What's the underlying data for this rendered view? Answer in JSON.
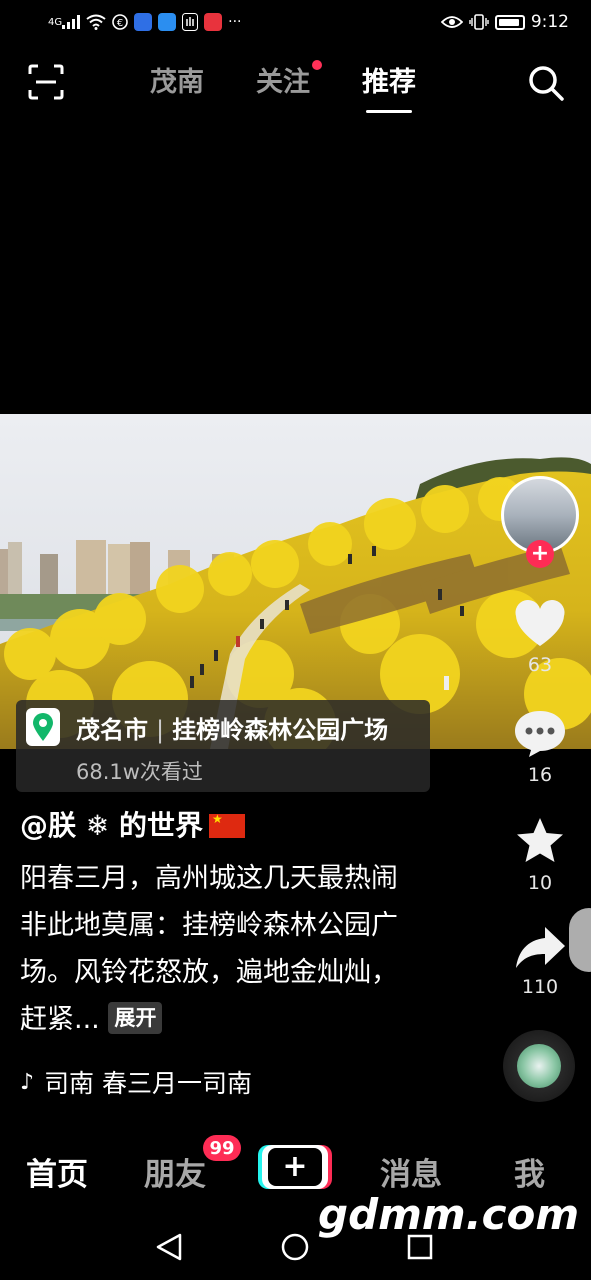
{
  "status_bar": {
    "signal": "4G",
    "more": "···",
    "time": "9:12"
  },
  "top_nav": {
    "tabs": [
      {
        "label": "茂南",
        "active": false
      },
      {
        "label": "关注",
        "active": false,
        "has_dot": true
      },
      {
        "label": "推荐",
        "active": true
      }
    ]
  },
  "video": {
    "location": {
      "city": "茂名市",
      "place": "挂榜岭森林公园广场",
      "views": "68.1w次看过"
    }
  },
  "rail": {
    "likes": "63",
    "comments": "16",
    "favorites": "10",
    "shares": "110"
  },
  "post": {
    "author": "@朕 ❄ 的世界",
    "caption": "阳春三月，高州城这几天最热闹非此地莫属：挂榜岭森林公园广场。风铃花怒放，遍地金灿灿，赶紧...",
    "expand_label": "展开",
    "music": "司南    春三月一司南"
  },
  "bottom_nav": {
    "home": "首页",
    "friends": "朋友",
    "friends_badge": "99",
    "plus": "+",
    "messages": "消息",
    "me": "我"
  },
  "watermark": "gdmm.com",
  "colors": {
    "accent_red": "#fe2c55",
    "accent_cyan": "#25f4ee",
    "location_green": "#12b76a"
  }
}
